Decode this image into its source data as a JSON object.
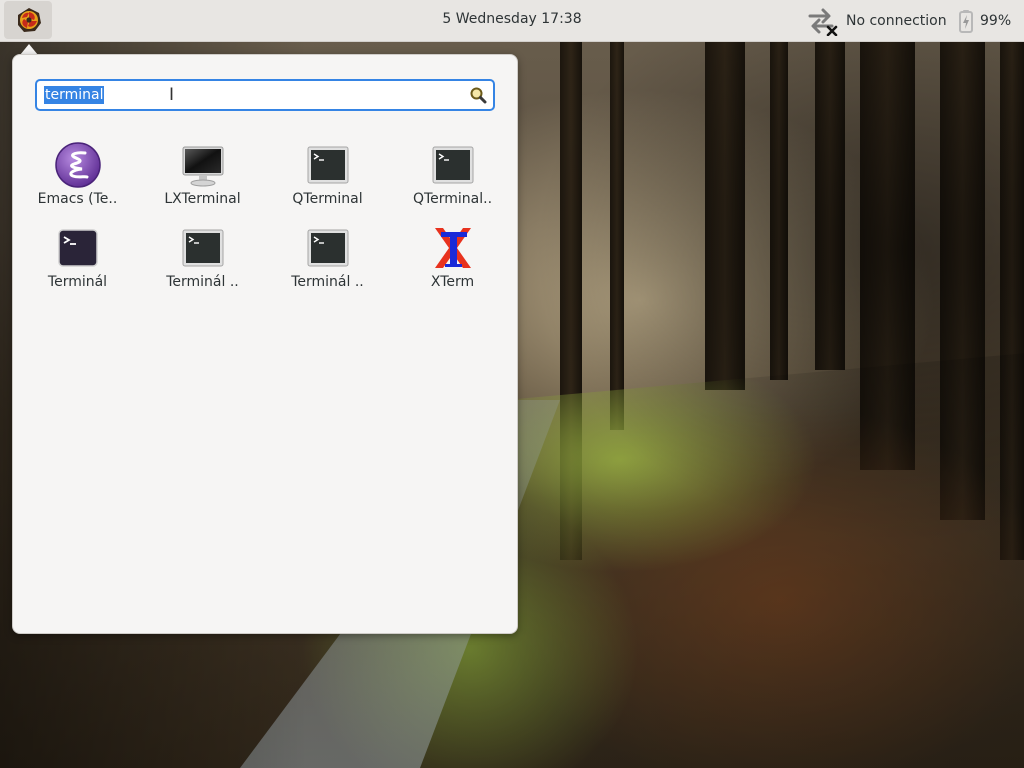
{
  "panel": {
    "clock": "5 Wednesday 17:38",
    "network_label": "No connection",
    "battery_label": "99%"
  },
  "menu": {
    "search_value": "terminal",
    "apps": [
      {
        "label": "Emacs (Te..",
        "icon": "emacs-icon"
      },
      {
        "label": "LXTerminal",
        "icon": "monitor-icon"
      },
      {
        "label": "QTerminal",
        "icon": "terminal-icon"
      },
      {
        "label": "QTerminal..",
        "icon": "terminal-icon"
      },
      {
        "label": "Terminál",
        "icon": "terminal-icon"
      },
      {
        "label": "Terminál ..",
        "icon": "terminal-icon"
      },
      {
        "label": "Terminál ..",
        "icon": "terminal-icon"
      },
      {
        "label": "XTerm",
        "icon": "xterm-icon"
      }
    ]
  },
  "colors": {
    "accent": "#3584e4",
    "panel_bg": "#e8e6e3",
    "popup_bg": "#f6f5f4"
  }
}
